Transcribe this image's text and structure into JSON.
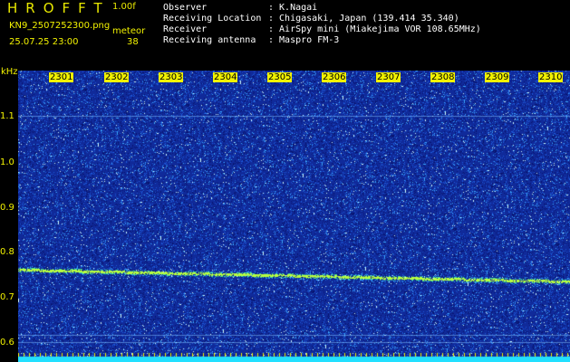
{
  "header": {
    "brand": "HROFFT",
    "version": "1.00f",
    "filename": "KN9_2507252300.png",
    "timestamp": "25.07.25 23:00",
    "meteor_label": "meteor",
    "meteor_count": "38",
    "info": [
      {
        "label": "Observer",
        "value": ": K.Nagai"
      },
      {
        "label": "Receiving Location",
        "value": ": Chigasaki, Japan (139.414 35.340)"
      },
      {
        "label": "Receiver",
        "value": ": AirSpy mini (Miakejima VOR 108.65MHz)"
      },
      {
        "label": "Receiving antenna",
        "value": ": Maspro FM-3"
      }
    ]
  },
  "axes": {
    "y_unit": "kHz",
    "y_ticks": [
      "1.1",
      "1.0",
      "0.9",
      "0.8",
      "0.7",
      "0.6"
    ],
    "x_ticks": [
      "2301",
      "2302",
      "2303",
      "2304",
      "2305",
      "2306",
      "2307",
      "2308",
      "2309",
      "2310"
    ]
  },
  "colors": {
    "background_noise": "#102a9a",
    "signal": "#9cff40",
    "label_yellow": "#f2f200",
    "baseline_cyan": "#22e0ff"
  }
}
